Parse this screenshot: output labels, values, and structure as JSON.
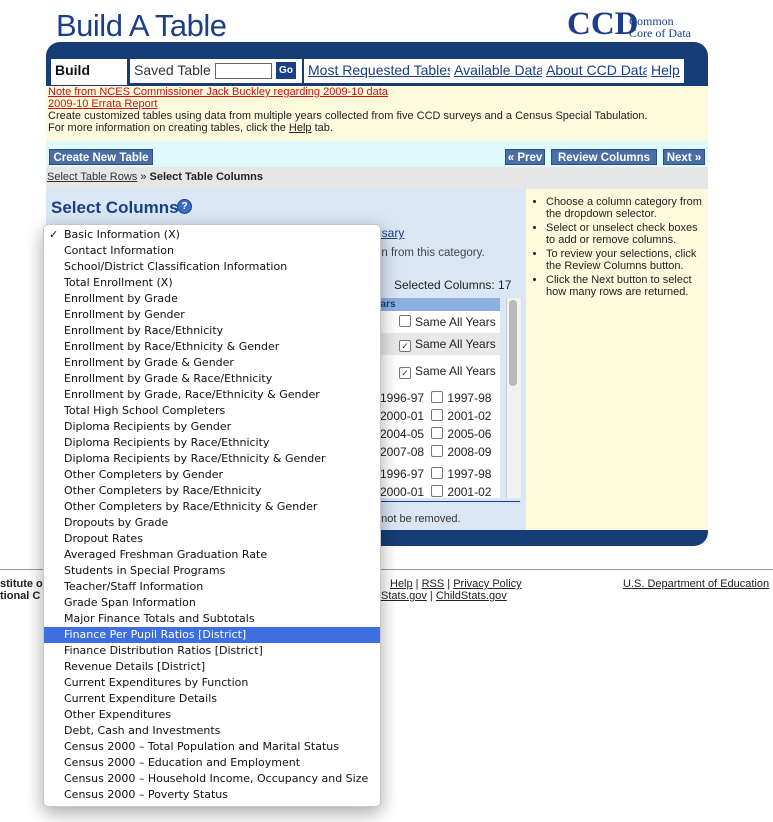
{
  "header": {
    "title": "Build A Table",
    "logo": "CCD",
    "logo_line1": "Common",
    "logo_line2": "Core of Data"
  },
  "tabs": {
    "build_table": "Build Table",
    "saved_table": "Saved Table",
    "saved_input_value": "",
    "go": "Go",
    "links": [
      "Most Requested Tables",
      "Available Data",
      "About CCD Data",
      "Help"
    ]
  },
  "info": {
    "note_link": "Note from NCES Commissioner Jack Buckley regarding 2009-10 data",
    "errata_link": "2009-10 Errata Report",
    "line1": "Create customized tables using data from multiple years collected from five CCD surveys and a Census Special Tabulation.",
    "line2_prefix": "For more information on creating tables, click the ",
    "line2_link": "Help",
    "line2_suffix": " tab."
  },
  "nav_buttons": {
    "create_new": "Create New Table",
    "prev": "« Prev",
    "review": "Review Columns",
    "next": "Next »"
  },
  "breadcrumb": {
    "step1": "Select Table Rows",
    "separator": " » ",
    "current": "Select Table Columns"
  },
  "main": {
    "heading": "Select Columns",
    "glossary": "ossary",
    "chosen_text": "en from this category.",
    "selected_count": "Selected Columns: 17",
    "years_header": "ears",
    "same_all_years": "Same All Years",
    "year_rows": [
      [
        "1996-97",
        "1997-98"
      ],
      [
        "2000-01",
        "2001-02"
      ],
      [
        "2004-05",
        "2005-06"
      ],
      [
        "2007-08",
        "2008-09"
      ],
      [
        "1996-97",
        "1997-98"
      ],
      [
        "2000-01",
        "2001-02"
      ]
    ],
    "cannot_remove": "nnot be removed."
  },
  "side": {
    "items": [
      "Choose a column category from the dropdown selector.",
      "Select or unselect check boxes to add or remove columns.",
      "To review your selections, click the Review Columns button.",
      "Click the Next button to select how many rows are returned."
    ]
  },
  "footer": {
    "left_line1": "stitute of",
    "left_line2": "tional C",
    "links_line1_a": "Help",
    "links_line1_b": "RSS",
    "links_line1_c": "Privacy Policy",
    "links_line2_a": "ildStats.gov",
    "links_line2_b": "ChildStats.gov",
    "sep": " | ",
    "right": "U.S. Department of Education"
  },
  "dropdown": {
    "check_mark": "✓",
    "selected_index": 0,
    "highlighted_index": 25,
    "options": [
      "Basic Information (X)",
      "Contact Information",
      "School/District Classification Information",
      "Total Enrollment (X)",
      "Enrollment by Grade",
      "Enrollment by Gender",
      "Enrollment by Race/Ethnicity",
      "Enrollment by Race/Ethnicity & Gender",
      "Enrollment by Grade & Gender",
      "Enrollment by Grade & Race/Ethnicity",
      "Enrollment by Grade, Race/Ethnicity & Gender",
      "Total High School Completers",
      "Diploma Recipients by Gender",
      "Diploma Recipients by Race/Ethnicity",
      "Diploma Recipients by Race/Ethnicity & Gender",
      "Other Completers by Gender",
      "Other Completers by Race/Ethnicity",
      "Other Completers by Race/Ethnicity & Gender",
      "Dropouts by Grade",
      "Dropout Rates",
      "Averaged Freshman Graduation Rate",
      "Students in Special Programs",
      "Teacher/Staff Information",
      "Grade Span Information",
      "Major Finance Totals and Subtotals",
      "Finance Per Pupil Ratios [District]",
      "Finance Distribution Ratios [District]",
      "Revenue Details [District]",
      "Current Expenditures by Function",
      "Current Expenditure Details",
      "Other Expenditures",
      "Debt, Cash and Investments",
      "Census 2000 – Total Population and Marital Status",
      "Census 2000 – Education and Employment",
      "Census 2000 – Household Income, Occupancy and Size",
      "Census 2000 – Poverty Status"
    ]
  },
  "colors": {
    "brand_blue": "#1b3f86",
    "highlight": "#3d6fe0",
    "info_bg": "#fefadd",
    "panel_bg": "#dbe6f5"
  }
}
